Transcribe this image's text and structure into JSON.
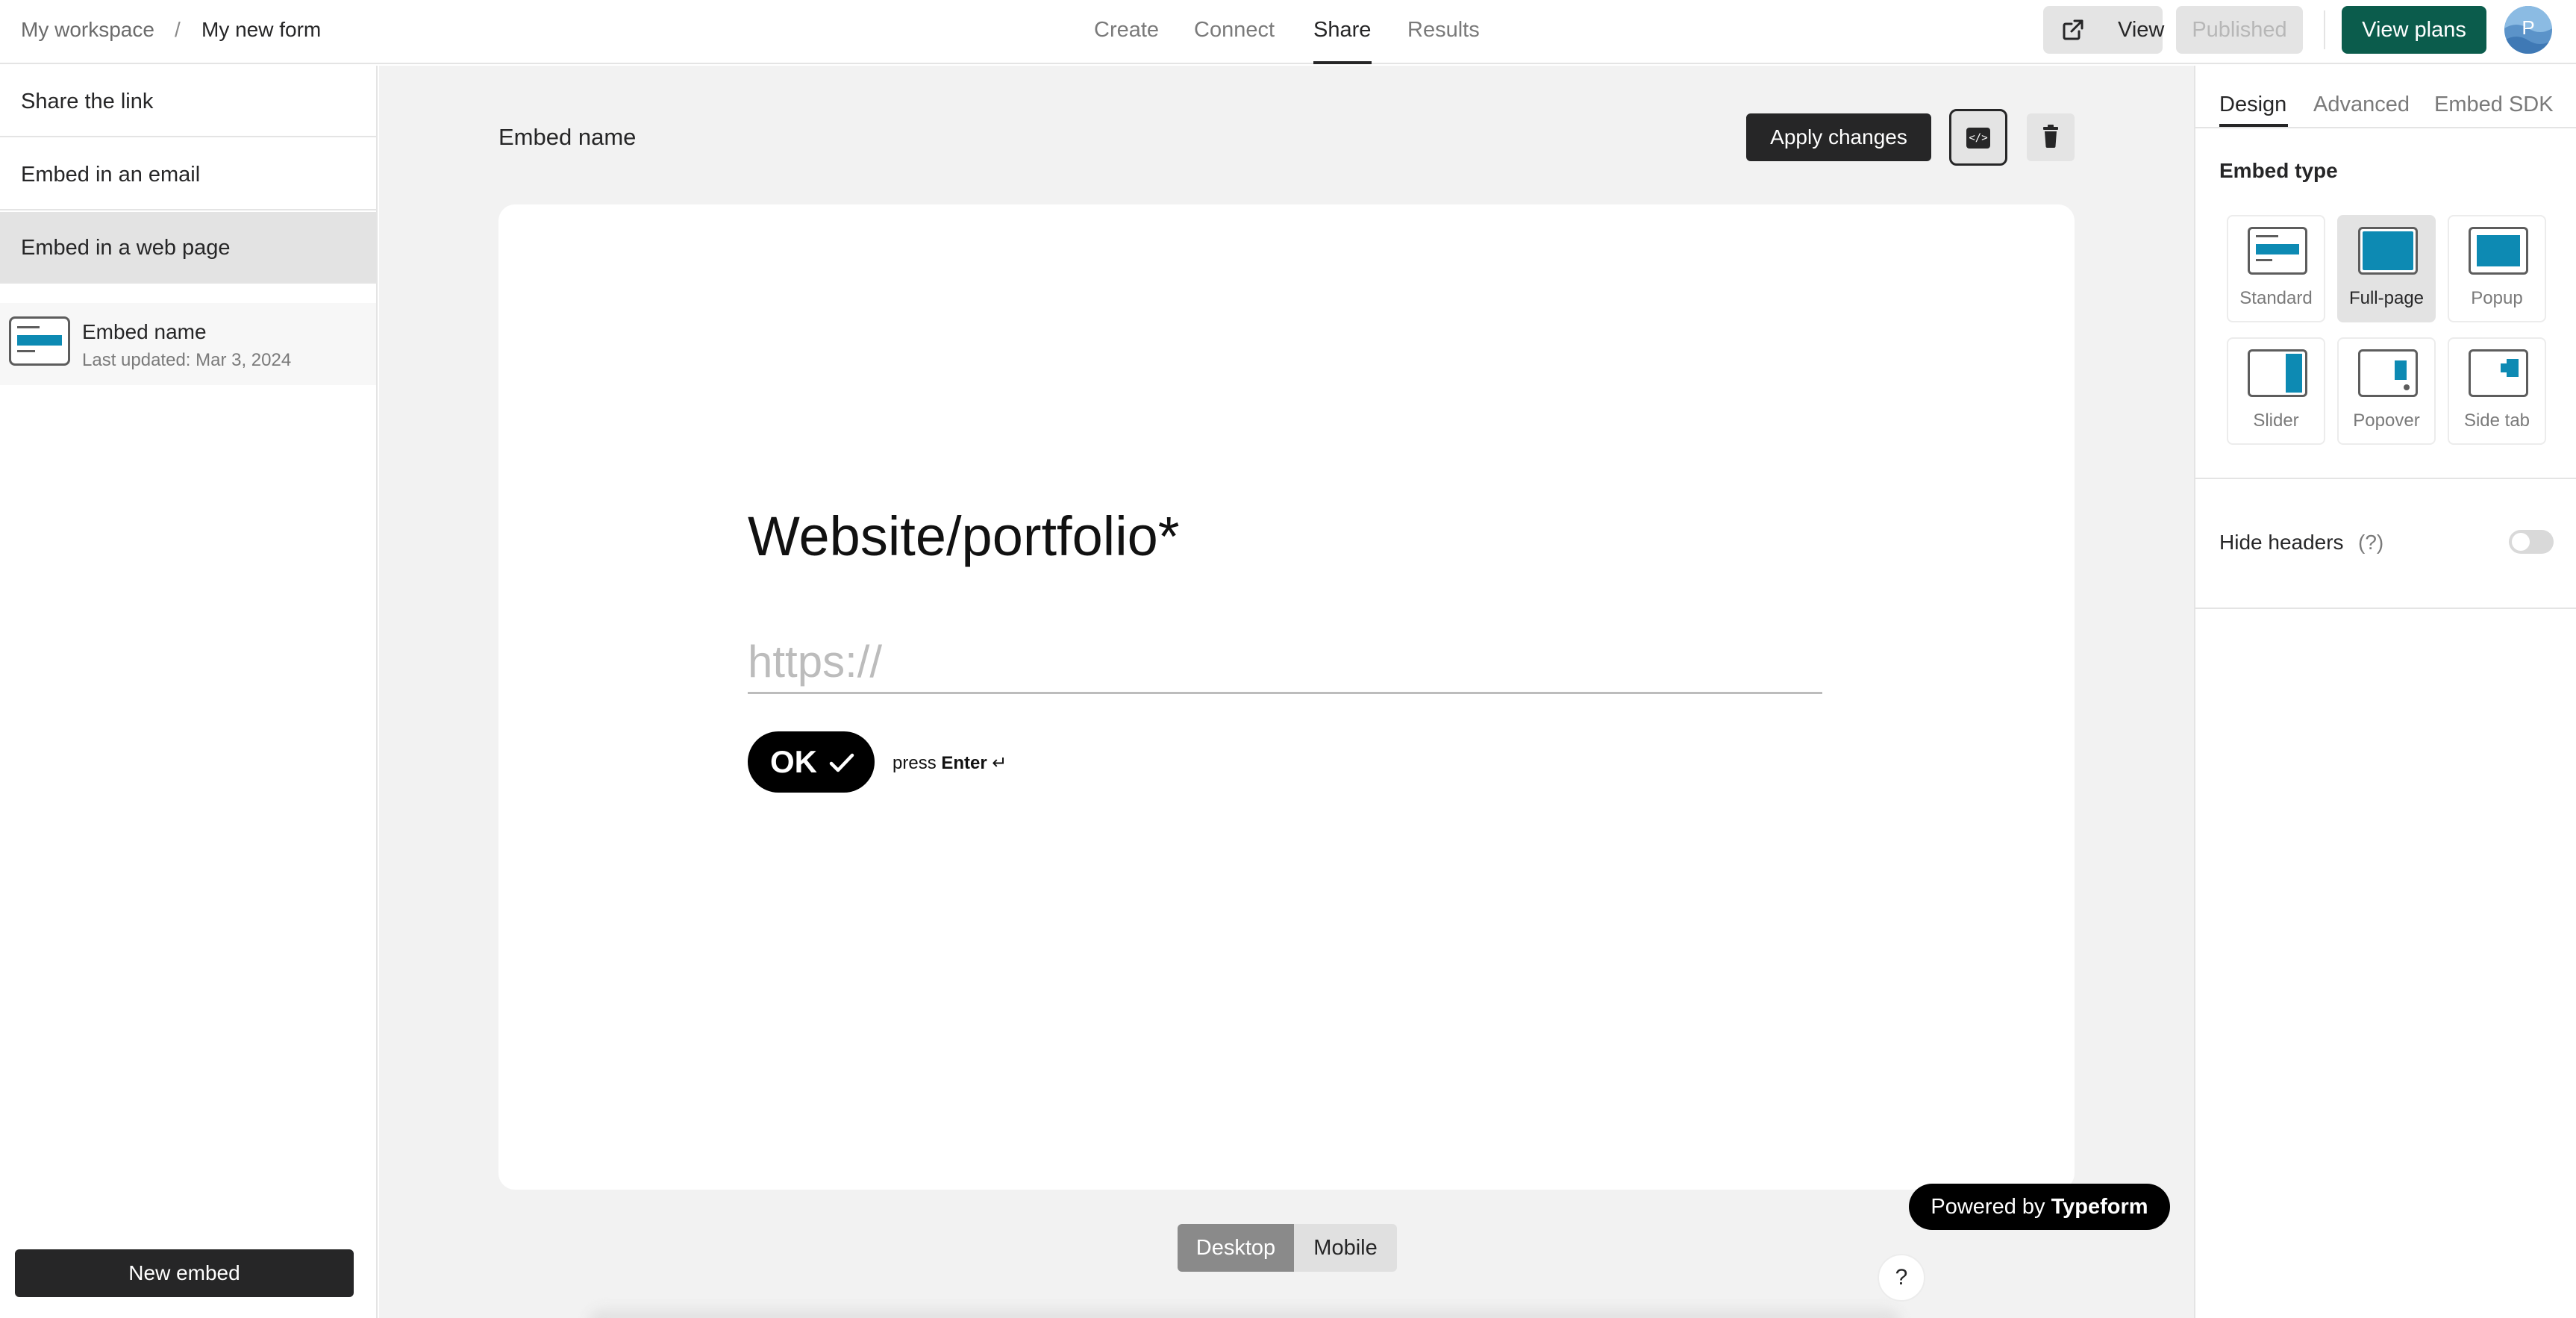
{
  "header": {
    "breadcrumb": {
      "workspace": "My workspace",
      "separator": "/",
      "form": "My new form"
    },
    "tabs": [
      {
        "label": "Create"
      },
      {
        "label": "Connect"
      },
      {
        "label": "Share"
      },
      {
        "label": "Results"
      }
    ],
    "active_tab": "Share",
    "view_label": "View",
    "published_label": "Published",
    "view_plans_label": "View plans",
    "avatar_letter": "P",
    "colors": {
      "view_plans_bg": "#0b5c4c",
      "avatar_bg": "#5b93c9"
    }
  },
  "sidebar": {
    "items": [
      {
        "label": "Share the link"
      },
      {
        "label": "Embed in an email"
      },
      {
        "label": "Embed in a web page"
      }
    ],
    "active_item": "Embed in a web page",
    "embed": {
      "title": "Embed name",
      "updated": "Last updated: Mar 3, 2024",
      "icon": "standard-embed-icon"
    },
    "new_embed_label": "New embed"
  },
  "main": {
    "embed_name": "Embed name",
    "apply_label": "Apply changes",
    "code_icon": "code-icon",
    "trash_icon": "trash-icon",
    "question": "Website/portfolio*",
    "input_placeholder": "https://",
    "ok_label": "OK",
    "press_prefix": "press",
    "press_key": "Enter",
    "press_glyph": "↵",
    "powered_prefix": "Powered by",
    "powered_brand": "Typeform",
    "view_modes": {
      "desktop": "Desktop",
      "mobile": "Mobile",
      "selected": "Desktop"
    },
    "help_label": "?"
  },
  "right_panel": {
    "tabs": [
      {
        "label": "Design"
      },
      {
        "label": "Advanced"
      },
      {
        "label": "Embed SDK"
      }
    ],
    "active_tab": "Design",
    "embed_type_title": "Embed type",
    "embed_types": [
      {
        "label": "Standard"
      },
      {
        "label": "Full-page"
      },
      {
        "label": "Popup"
      },
      {
        "label": "Slider"
      },
      {
        "label": "Popover"
      },
      {
        "label": "Side tab"
      }
    ],
    "selected_type": "Full-page",
    "hide_headers_label": "Hide headers",
    "hide_headers_hint": "(?)",
    "hide_headers_on": false,
    "accent": "#0d8ab3"
  }
}
